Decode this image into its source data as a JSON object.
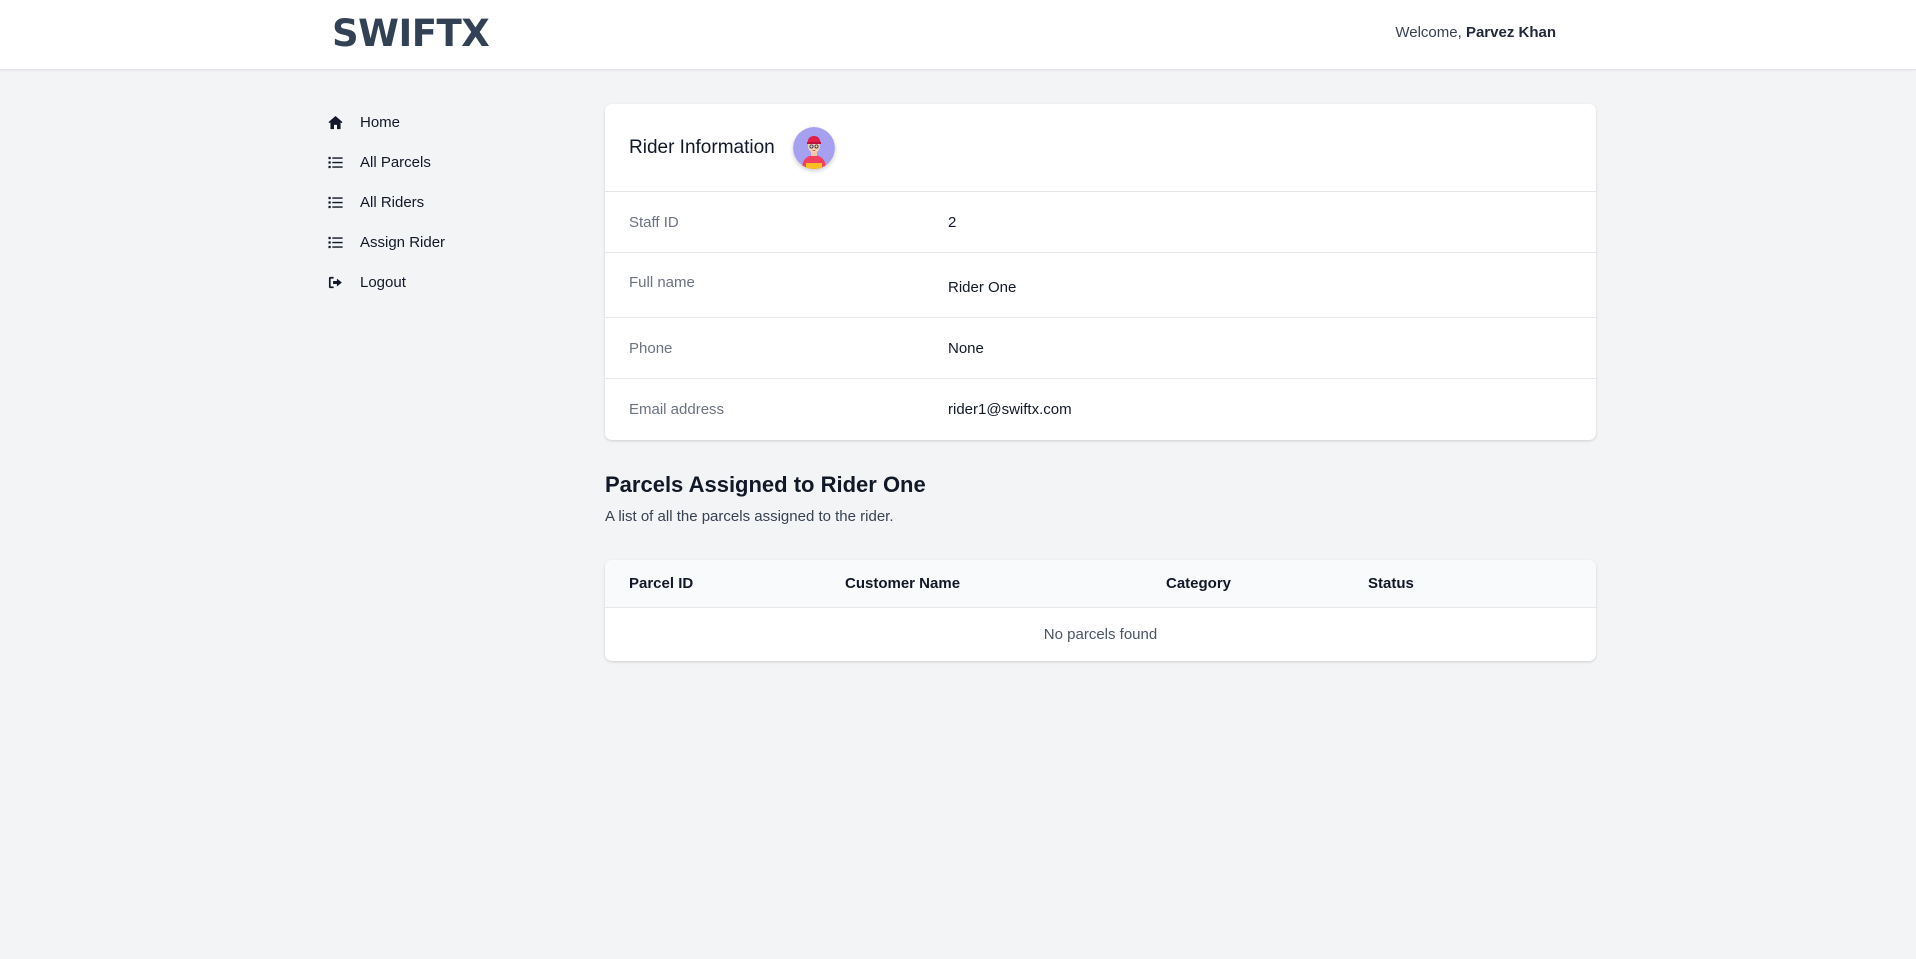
{
  "header": {
    "brand": "SWIFTX",
    "welcome_prefix": "Welcome,",
    "user_name": "Parvez Khan"
  },
  "sidebar": {
    "items": [
      {
        "label": "Home",
        "icon": "home-icon"
      },
      {
        "label": "All Parcels",
        "icon": "list-icon"
      },
      {
        "label": "All Riders",
        "icon": "list-icon"
      },
      {
        "label": "Assign Rider",
        "icon": "list-icon"
      },
      {
        "label": "Logout",
        "icon": "logout-icon"
      }
    ]
  },
  "rider_info": {
    "title": "Rider Information",
    "fields": [
      {
        "label": "Staff ID",
        "value": "2"
      },
      {
        "label": "Full name",
        "value": "Rider One"
      },
      {
        "label": "Phone",
        "value": "None"
      },
      {
        "label": "Email address",
        "value": "rider1@swiftx.com"
      }
    ]
  },
  "parcels": {
    "title": "Parcels Assigned to Rider One",
    "subtitle": "A list of all the parcels assigned to the rider.",
    "columns": [
      "Parcel ID",
      "Customer Name",
      "Category",
      "Status"
    ],
    "empty_message": "No parcels found"
  }
}
